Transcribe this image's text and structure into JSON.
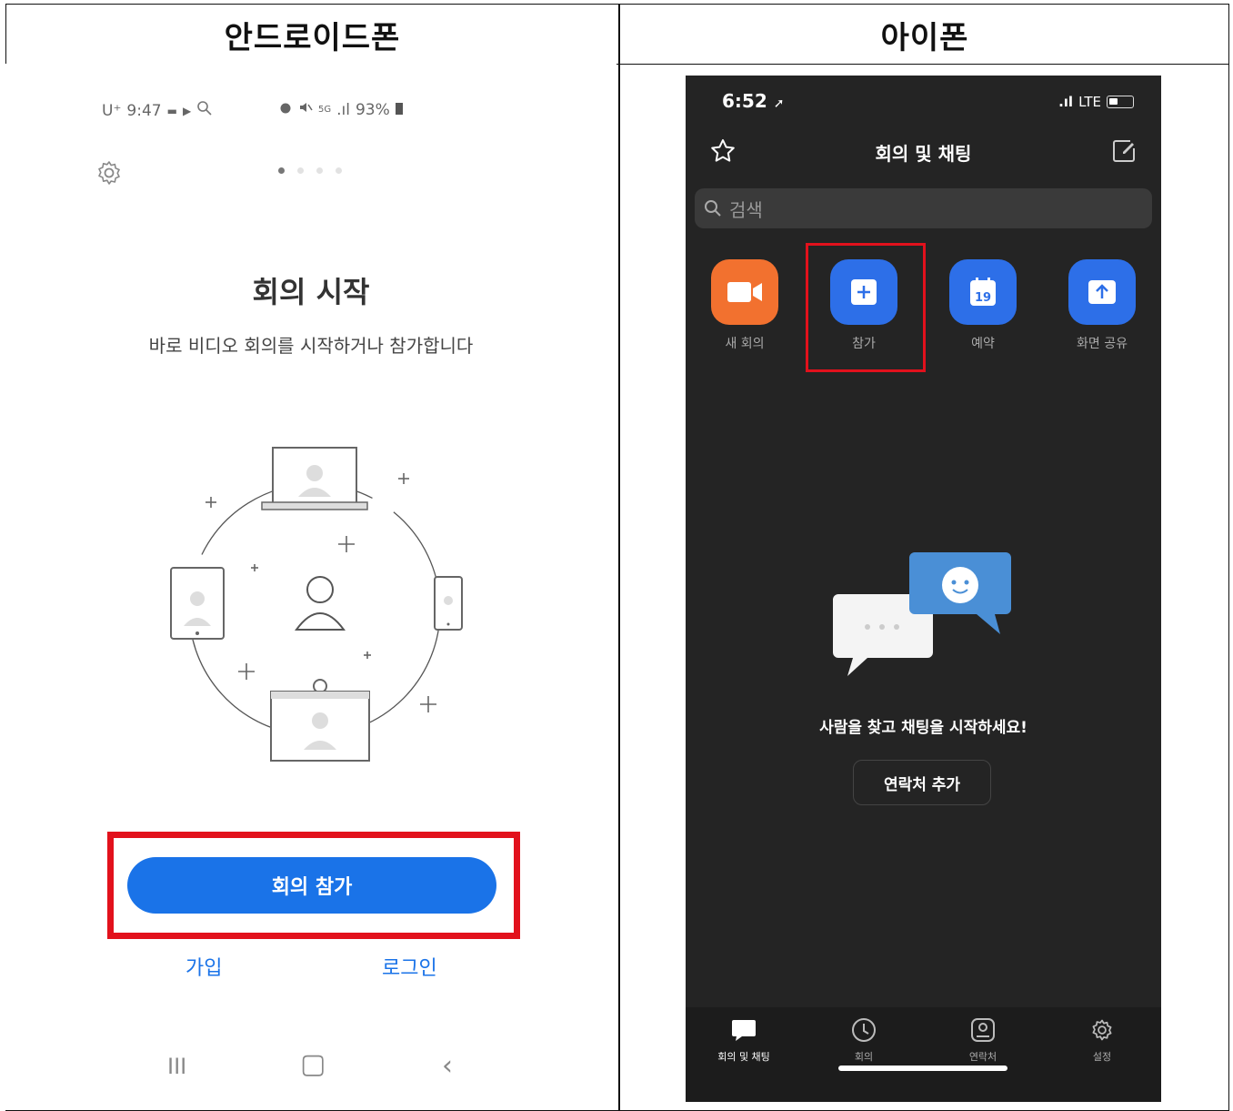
{
  "headers": {
    "android": "안드로이드폰",
    "iphone": "아이폰"
  },
  "android": {
    "status_left": [
      "U⁺",
      "9:47",
      "▬",
      "▶",
      "🔍"
    ],
    "status_right": [
      "⏰",
      "🔇",
      "5G",
      ".ıl",
      "93%",
      "▮"
    ],
    "page_dots": 4,
    "title": "회의 시작",
    "subtitle": "바로 비디오 회의를 시작하거나 참가합니다",
    "join_button": "회의 참가",
    "signup_link": "가입",
    "login_link": "로그인",
    "nav": [
      "III",
      "▢",
      "‹"
    ]
  },
  "iphone": {
    "time": "6:52",
    "signal": ".ıl",
    "network": "LTE",
    "title": "회의 및 채팅",
    "search_placeholder": "검색",
    "tiles": [
      {
        "label": "새 회의",
        "icon": "video-camera-icon",
        "color": "#f2712f"
      },
      {
        "label": "참가",
        "icon": "plus-icon",
        "color": "#2d6fe8"
      },
      {
        "label": "예약",
        "icon": "calendar-icon",
        "color": "#2d6fe8",
        "day": "19"
      },
      {
        "label": "화면 공유",
        "icon": "share-screen-icon",
        "color": "#2d6fe8"
      }
    ],
    "empty_message": "사람을 찾고 채팅을 시작하세요!",
    "add_contact": "연락처 추가",
    "tabs": [
      {
        "label": "회의 및 채팅",
        "icon": "chat-bubble-icon",
        "active": true
      },
      {
        "label": "회의",
        "icon": "clock-icon",
        "active": false
      },
      {
        "label": "연락처",
        "icon": "contact-icon",
        "active": false
      },
      {
        "label": "설정",
        "icon": "gear-icon",
        "active": false
      }
    ]
  }
}
